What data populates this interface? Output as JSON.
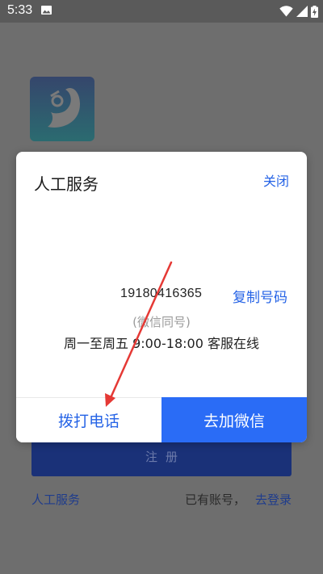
{
  "status_bar": {
    "time": "5:33",
    "icons": [
      "image-icon",
      "wifi-icon",
      "signal-icon",
      "battery-charging-icon"
    ]
  },
  "app": {
    "logo_icon": "app-logo-icon",
    "register_label": "注册",
    "manual_service_link": "人工服务",
    "has_account_text": "已有账号，",
    "login_link": "去登录"
  },
  "modal": {
    "title": "人工服务",
    "close_label": "关闭",
    "phone_number": "19180416365",
    "copy_label": "复制号码",
    "wechat_same": "(微信同号)",
    "service_hours": "周一至周五 9:00-18:00 客服在线",
    "call_label": "拨打电话",
    "wechat_label": "去加微信"
  },
  "colors": {
    "accent": "#2563e6",
    "primary_button": "#2a6cf6",
    "annotation_arrow": "#e53935",
    "dim_background": "#6e6e6e"
  }
}
